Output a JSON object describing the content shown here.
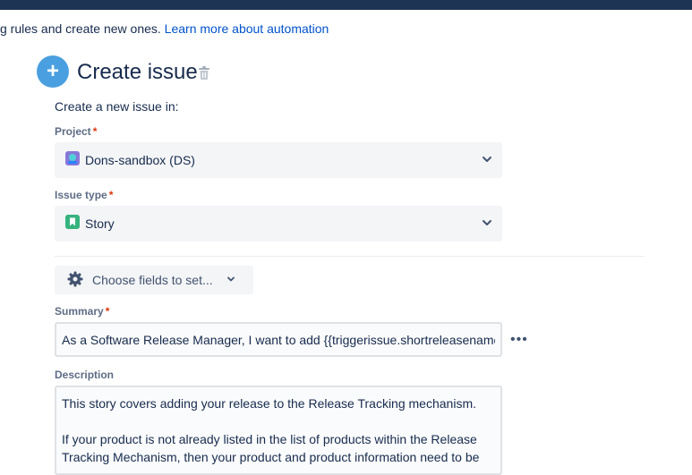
{
  "intro": {
    "text": "g rules and create new ones.",
    "link": "Learn more about automation"
  },
  "action": {
    "icon": "plus-icon",
    "title": "Create issue",
    "delete_icon": "trash-icon"
  },
  "form": {
    "subtitle": "Create a new issue in:",
    "project": {
      "label": "Project",
      "required_mark": "*",
      "value": "Dons-sandbox (DS)",
      "icon": "project-avatar-icon"
    },
    "issue_type": {
      "label": "Issue type",
      "required_mark": "*",
      "value": "Story",
      "icon": "story-icon"
    },
    "choose_fields": {
      "label": "Choose fields to set...",
      "icon": "gear-icon"
    },
    "summary": {
      "label": "Summary",
      "required_mark": "*",
      "value": "As a Software Release Manager, I want to add {{triggerissue.shortreleasename"
    },
    "description": {
      "label": "Description",
      "paragraphs": [
        "This story covers adding your release to the Release Tracking mechanism.",
        "If your product is not already listed in the list of products within the Release Tracking Mechanism, then your product and product information need to be"
      ]
    }
  },
  "colors": {
    "topbar": "#1d3454",
    "link": "#0052cc",
    "accent": "#4a9fe0",
    "required": "#de350b"
  }
}
